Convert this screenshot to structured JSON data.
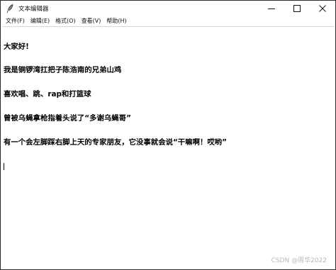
{
  "window": {
    "title": "文本编辑器",
    "icon": "feather-pen-icon"
  },
  "menubar": {
    "items": [
      {
        "label": "文件(F)"
      },
      {
        "label": "编辑(E)"
      },
      {
        "label": "格式(O)"
      },
      {
        "label": "查看(V)"
      },
      {
        "label": "帮助(H)"
      }
    ]
  },
  "editor": {
    "lines": [
      "大家好!",
      "我是铜锣湾扛把子陈浩南的兄弟山鸡",
      "喜欢唱、跳、rap和打篮球",
      "曾被乌蝇拿枪指着头说了“多谢乌蝇哥”",
      "有一个会左脚踩右脚上天的专家朋友，它没事就会说“干嘛啊！哎哟”"
    ]
  },
  "watermark": "CSDN @周华2022"
}
